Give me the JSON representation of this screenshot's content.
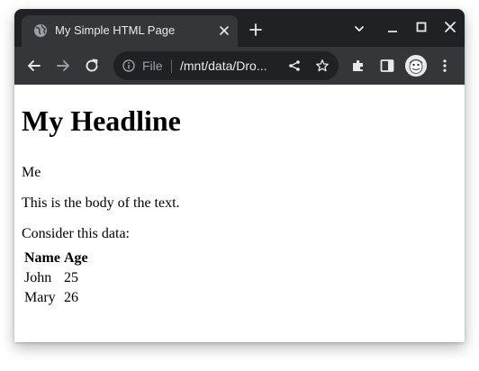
{
  "browser": {
    "tab": {
      "title": "My Simple HTML Page"
    },
    "omnibox": {
      "scheme_label": "File",
      "url": "/mnt/data/Dro..."
    }
  },
  "page": {
    "headline": "My Headline",
    "author": "Me",
    "body_text": "This is the body of the text.",
    "intro": "Consider this data:",
    "table": {
      "headers": [
        "Name",
        "Age"
      ],
      "rows": [
        [
          "John",
          "25"
        ],
        [
          "Mary",
          "26"
        ]
      ]
    }
  },
  "colors": {
    "tab_strip": "#202124",
    "toolbar": "#35363a",
    "omnibox": "#202124",
    "icon": "#e8eaed"
  },
  "icons": {
    "tab_favicon": "globe-icon",
    "tab_close": "close-icon",
    "new_tab": "plus-icon",
    "tab_search": "chevron-down-icon",
    "minimize": "minimize-icon",
    "maximize": "maximize-icon",
    "close_window": "close-icon",
    "back": "arrow-left-icon",
    "forward": "arrow-right-icon",
    "reload": "reload-icon",
    "site_info": "info-icon",
    "share": "share-icon",
    "bookmark": "star-icon",
    "extensions": "puzzle-icon",
    "side_panel": "side-panel-icon",
    "profile": "avatar",
    "menu": "kebab-menu-icon"
  }
}
